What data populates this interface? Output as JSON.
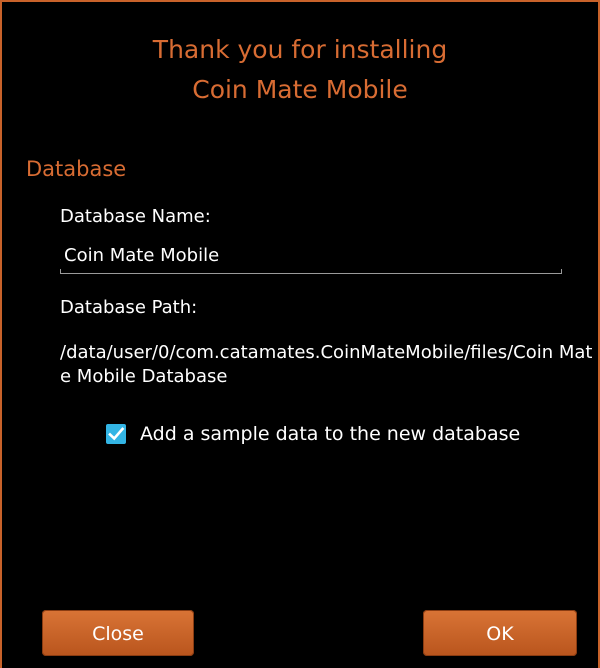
{
  "dialog": {
    "title_line1": "Thank you for installing",
    "title_line2": "Coin Mate Mobile",
    "section": "Database",
    "db_name_label": "Database Name:",
    "db_name_value": "Coin Mate Mobile",
    "db_path_label": "Database Path:",
    "db_path_value": "/data/user/0/com.catamates.CoinMateMobile/files/Coin Mate Mobile Database",
    "sample_checkbox_label": "Add a sample data to the new database",
    "sample_checked": true,
    "close_label": "Close",
    "ok_label": "OK"
  },
  "colors": {
    "accent": "#d86c33",
    "checkbox": "#33b5e5",
    "background": "#000000"
  }
}
